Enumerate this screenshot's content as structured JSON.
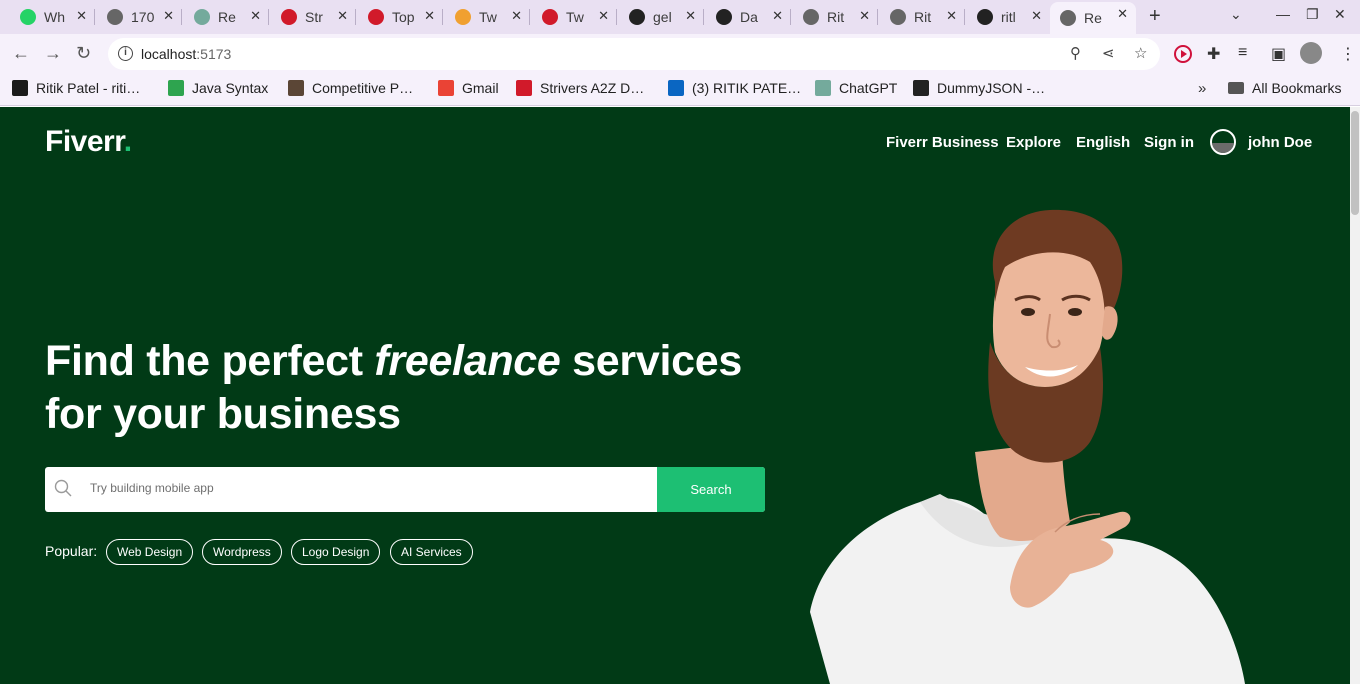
{
  "browser": {
    "tabs": [
      {
        "title": "Wh",
        "icon": "whatsapp-icon",
        "color": "#25d366"
      },
      {
        "title": "170",
        "icon": "globe-icon",
        "color": "#666666"
      },
      {
        "title": "Re",
        "icon": "chatgpt-icon",
        "color": "#74aa9c"
      },
      {
        "title": "Str",
        "icon": "tuf-icon",
        "color": "#d11a2a"
      },
      {
        "title": "Top",
        "icon": "tuf-icon",
        "color": "#d11a2a"
      },
      {
        "title": "Tw",
        "icon": "pen-icon",
        "color": "#f0a030"
      },
      {
        "title": "Tw",
        "icon": "tuf-icon",
        "color": "#d11a2a"
      },
      {
        "title": "gel",
        "icon": "github-icon",
        "color": "#222222"
      },
      {
        "title": "Da",
        "icon": "check-circle-icon",
        "color": "#222222"
      },
      {
        "title": "Rit",
        "icon": "globe-icon",
        "color": "#666666"
      },
      {
        "title": "Rit",
        "icon": "globe-icon",
        "color": "#666666"
      },
      {
        "title": "ritl",
        "icon": "github-icon",
        "color": "#222222"
      },
      {
        "title": "Re",
        "icon": "globe-icon",
        "color": "#666666",
        "active": true
      }
    ],
    "url_host": "localhost",
    "url_port": ":5173",
    "bookmarks": [
      {
        "label": "Ritik Patel - riti…",
        "icon": "nd-icon",
        "color": "#1b1b1b"
      },
      {
        "label": "Java Syntax",
        "icon": "w-icon",
        "color": "#2ea44f"
      },
      {
        "label": "Competitive P…",
        "icon": "cc-icon",
        "color": "#5b4636"
      },
      {
        "label": "Gmail",
        "icon": "gmail-icon",
        "color": "#ea4335"
      },
      {
        "label": "Strivers A2Z D…",
        "icon": "tuf-icon",
        "color": "#d11a2a"
      },
      {
        "label": "(3) RITIK PATE…",
        "icon": "linkedin-icon",
        "color": "#0a66c2"
      },
      {
        "label": "ChatGPT",
        "icon": "chatgpt-icon",
        "color": "#74aa9c"
      },
      {
        "label": "DummyJSON -…",
        "icon": "dummyjson-icon",
        "color": "#222222"
      }
    ],
    "bookmarks_more": "»",
    "all_bookmarks": "All Bookmarks"
  },
  "site": {
    "logo": "Fiverr",
    "logo_dot": ".",
    "nav": {
      "business": "Fiverr Business",
      "explore": "Explore",
      "language": "English",
      "signin": "Sign in",
      "username": "john Doe"
    },
    "hero": {
      "title_part1": "Find the perfect ",
      "title_em": "freelance",
      "title_part2": " services",
      "title_line2": "for your business"
    },
    "search": {
      "placeholder": "Try building mobile app",
      "button": "Search"
    },
    "popular": {
      "label": "Popular:",
      "tags": [
        "Web Design",
        "Wordpress",
        "Logo Design",
        "AI Services"
      ]
    },
    "colors": {
      "bg": "#013a16",
      "accent": "#1dbf73"
    }
  }
}
